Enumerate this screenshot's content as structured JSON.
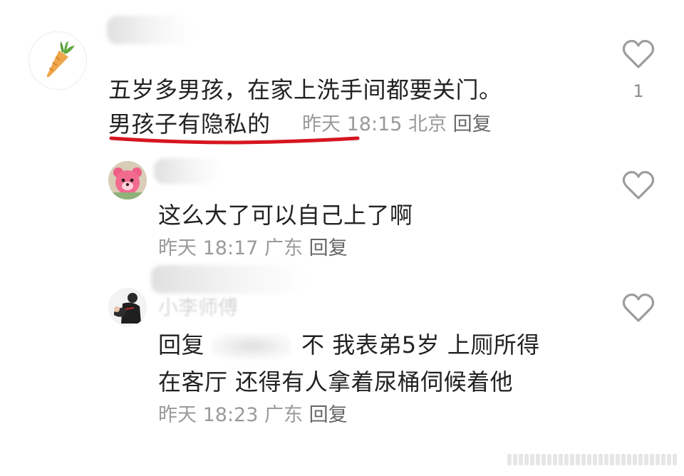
{
  "comments": [
    {
      "text_line1": "五岁多男孩，在家上洗手间都要关门。",
      "text_line2_highlight": "男孩子有隐私的",
      "time": "昨天 18:15",
      "location": "北京",
      "reply_label": "回复",
      "likes": "1",
      "avatar_icon": "carrot-icon"
    },
    {
      "text": "这么大了可以自己上了啊",
      "time": "昨天 18:17",
      "location": "广东",
      "reply_label": "回复",
      "avatar_icon": "pink-bear-avatar"
    },
    {
      "name_partial": "小李师傅",
      "reply_prefix": "回复",
      "text_line1": "不 我表弟5岁 上厕所得",
      "text_line2": "在客厅 还得有人拿着尿桶伺候着他",
      "time": "昨天 18:23",
      "location": "广东",
      "reply_label": "回复",
      "avatar_icon": "person-avatar"
    }
  ],
  "colors": {
    "underline": "#d6161f",
    "meta": "#9a9a9a",
    "text": "#222222",
    "heart": "#9c9c9c"
  }
}
